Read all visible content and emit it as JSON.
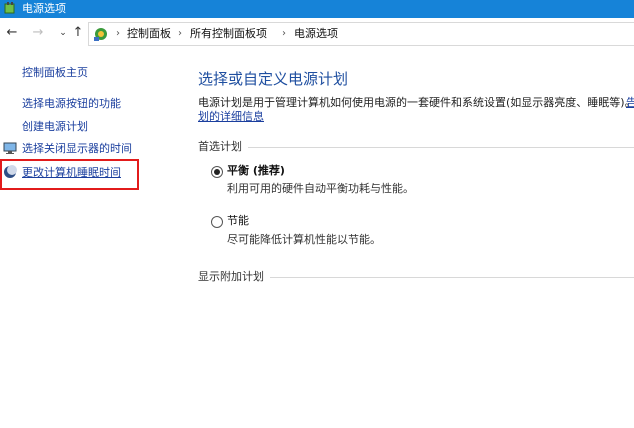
{
  "window": {
    "title": "电源选项"
  },
  "nav": {
    "back_icon": "arrow-left-icon",
    "forward_icon": "arrow-right-icon",
    "recent_icon": "chevron-down-icon",
    "up_icon": "arrow-up-icon",
    "breadcrumb": [
      "控制面板",
      "所有控制面板项",
      "电源选项"
    ]
  },
  "sidebar": {
    "home": "控制面板主页",
    "items": [
      {
        "label": "选择电源按钮的功能"
      },
      {
        "label": "创建电源计划"
      },
      {
        "label": "选择关闭显示器的时间",
        "icon": "monitor-icon"
      },
      {
        "label": "更改计算机睡眠时间",
        "icon": "moon-icon"
      }
    ]
  },
  "main": {
    "title": "选择或自定义电源计划",
    "description_line1": "电源计划是用于管理计算机如何使用电源的一套硬件和系统设置(如显示器亮度、睡眠等)。",
    "description_link_start": "告",
    "description_line2_link": "划的详细信息",
    "preferred_label": "首选计划",
    "plans": [
      {
        "name": "平衡 (推荐)",
        "description": "利用可用的硬件自动平衡功耗与性能。",
        "selected": true
      },
      {
        "name": "节能",
        "description": "尽可能降低计算机性能以节能。",
        "selected": false
      }
    ],
    "additional_label": "显示附加计划"
  },
  "colors": {
    "titlebar": "#1683d8",
    "link": "#1a3e9e",
    "title": "#1f4fa0",
    "highlight": "#e21b1b"
  }
}
